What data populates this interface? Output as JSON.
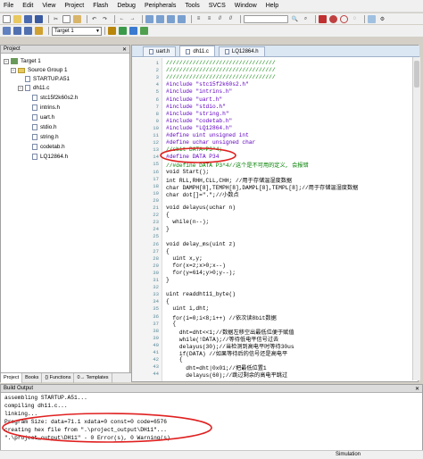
{
  "menubar": [
    "File",
    "Edit",
    "View",
    "Project",
    "Flash",
    "Debug",
    "Peripherals",
    "Tools",
    "SVCS",
    "Window",
    "Help"
  ],
  "toolbar2": {
    "target": "Target 1"
  },
  "project_panel": {
    "title": "Project",
    "tree": {
      "target": "Target 1",
      "group": "Source Group 1",
      "files": [
        "STARTUP.A51",
        "dh11.c"
      ],
      "includes": [
        "stc15f2k60s2.h",
        "intrins.h",
        "uart.h",
        "stdio.h",
        "string.h",
        "codetab.h",
        "LQ12864.h"
      ]
    },
    "tabs": [
      "Project",
      "Books",
      "{} Functions",
      "0→ Templates"
    ]
  },
  "editor": {
    "tabs": [
      "uart.h",
      "dh11.c",
      "LQ12864.h"
    ],
    "active_tab": "dh11.c",
    "line_numbers": [
      "1",
      "2",
      "3",
      "4",
      "5",
      "6",
      "7",
      "8",
      "9",
      "10",
      "11",
      "12",
      "13",
      "14",
      "15",
      "16",
      "17",
      "18",
      "19",
      "20",
      "21",
      "22",
      "23",
      "24",
      "25",
      "26",
      "27",
      "28",
      "29",
      "30",
      "31",
      "32",
      "33",
      "34",
      "35",
      "36",
      "37",
      "38",
      "39",
      "40",
      "41",
      "42",
      "43",
      "44"
    ],
    "lines": [
      {
        "cls": "cm",
        "text": "/////////////////////////////////"
      },
      {
        "cls": "cm",
        "text": "/////////////////////////////////"
      },
      {
        "cls": "cm",
        "text": "/////////////////////////////////"
      },
      {
        "cls": "pp",
        "text": "#include \"stc15f2k60s2.h\""
      },
      {
        "cls": "pp",
        "text": "#include \"intrins.h\""
      },
      {
        "cls": "pp",
        "text": "#include \"uart.h\""
      },
      {
        "cls": "pp",
        "text": "#include \"stdio.h\""
      },
      {
        "cls": "pp",
        "text": "#include \"string.h\""
      },
      {
        "cls": "pp",
        "text": "#include \"codetab.h\""
      },
      {
        "cls": "pp",
        "text": "#include \"LQ12864.h\""
      },
      {
        "cls": "pp",
        "text": "#define uint unsigned int"
      },
      {
        "cls": "pp",
        "text": "#define uchar unsigned char"
      },
      {
        "cls": "cm",
        "text": "//sbit DATA=P3^4;"
      },
      {
        "cls": "pp",
        "text": "#define DATA P34"
      },
      {
        "cls": "cm",
        "text": "//#define DATA P3^4//这个是不可用的定义, 会报错"
      },
      {
        "cls": "",
        "text": "void Start();"
      },
      {
        "cls": "",
        "text": "int RLL,RHH,CLL,CHH; //用于存储温湿度数据"
      },
      {
        "cls": "",
        "text": "char DAMPH[8],TEMPH[8],DAMPL[8],TEMPL[8];//用于存储温湿度数据"
      },
      {
        "cls": "",
        "text": "char dot[]=\".\";//小数点"
      },
      {
        "cls": "",
        "text": ""
      },
      {
        "cls": "",
        "text": "void delayus(uchar n)"
      },
      {
        "cls": "",
        "text": "{"
      },
      {
        "cls": "",
        "text": "  while(n--);"
      },
      {
        "cls": "",
        "text": "}"
      },
      {
        "cls": "",
        "text": ""
      },
      {
        "cls": "",
        "text": "void delay_ms(uint z)"
      },
      {
        "cls": "",
        "text": "{"
      },
      {
        "cls": "",
        "text": "  uint x,y;"
      },
      {
        "cls": "",
        "text": "  for(x=z;x>0;x--)"
      },
      {
        "cls": "",
        "text": "  for(y=614;y>0;y--);"
      },
      {
        "cls": "",
        "text": "}"
      },
      {
        "cls": "",
        "text": ""
      },
      {
        "cls": "",
        "text": "uint readdht11_byte()"
      },
      {
        "cls": "",
        "text": "{"
      },
      {
        "cls": "",
        "text": "  uint i,dht;"
      },
      {
        "cls": "",
        "text": "  for(i=0;i<8;i++) //依次读8bit数据"
      },
      {
        "cls": "",
        "text": "  {"
      },
      {
        "cls": "",
        "text": "    dht=dht<<1;//数据左移空出最低位便于赋值"
      },
      {
        "cls": "",
        "text": "    while(!DATA);//等待低电平信号过去"
      },
      {
        "cls": "",
        "text": "    delayus(30);//当检测到高电平时等待30us"
      },
      {
        "cls": "",
        "text": "    if(DATA) //如果等待后的信号还是高电平"
      },
      {
        "cls": "",
        "text": "    {"
      },
      {
        "cls": "",
        "text": "      dht=dht|0x01;//把最低位置1"
      },
      {
        "cls": "",
        "text": "      delayus(60);//跳过剩余的高电平跳过"
      }
    ]
  },
  "build_output": {
    "title": "Build Output",
    "lines": [
      "assembling STARTUP.A51...",
      "compiling dh11.c...",
      "linking...",
      "Program Size: data=71.1 xdata=0 const=0 code=6576",
      "creating hex file from \".\\project_output\\DH11\"...",
      "\".\\project_output\\DH11\" - 0 Error(s), 0 Warning(s)."
    ]
  },
  "status": {
    "mode": "Simulation"
  },
  "colors": {
    "comment": "#008000",
    "preproc": "#6000c0",
    "keyword": "#0000d0",
    "annotation": "#e02020"
  }
}
